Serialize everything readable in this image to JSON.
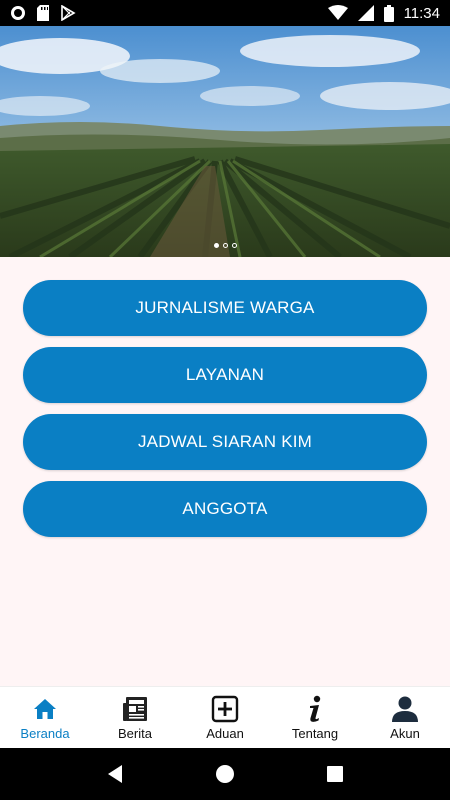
{
  "status_bar": {
    "time": "11:34",
    "icons": [
      "circle-notification-icon",
      "sd-card-icon",
      "play-store-icon",
      "wifi-icon",
      "signal-icon",
      "battery-icon"
    ]
  },
  "banner": {
    "image": "vineyard-landscape",
    "slides": 3,
    "active_slide": 1
  },
  "menu": {
    "buttons": [
      {
        "label": "JURNALISME WARGA"
      },
      {
        "label": "LAYANAN"
      },
      {
        "label": "JADWAL SIARAN KIM"
      },
      {
        "label": "ANGGOTA"
      }
    ]
  },
  "bottom_nav": {
    "items": [
      {
        "label": "Beranda",
        "icon": "home-icon",
        "active": true
      },
      {
        "label": "Berita",
        "icon": "newspaper-icon",
        "active": false
      },
      {
        "label": "Aduan",
        "icon": "add-box-icon",
        "active": false
      },
      {
        "label": "Tentang",
        "icon": "info-icon",
        "active": false
      },
      {
        "label": "Akun",
        "icon": "person-icon",
        "active": false
      }
    ]
  },
  "colors": {
    "primary": "#0a7fc4",
    "background": "#fff5f6",
    "status_bar": "#000000"
  }
}
